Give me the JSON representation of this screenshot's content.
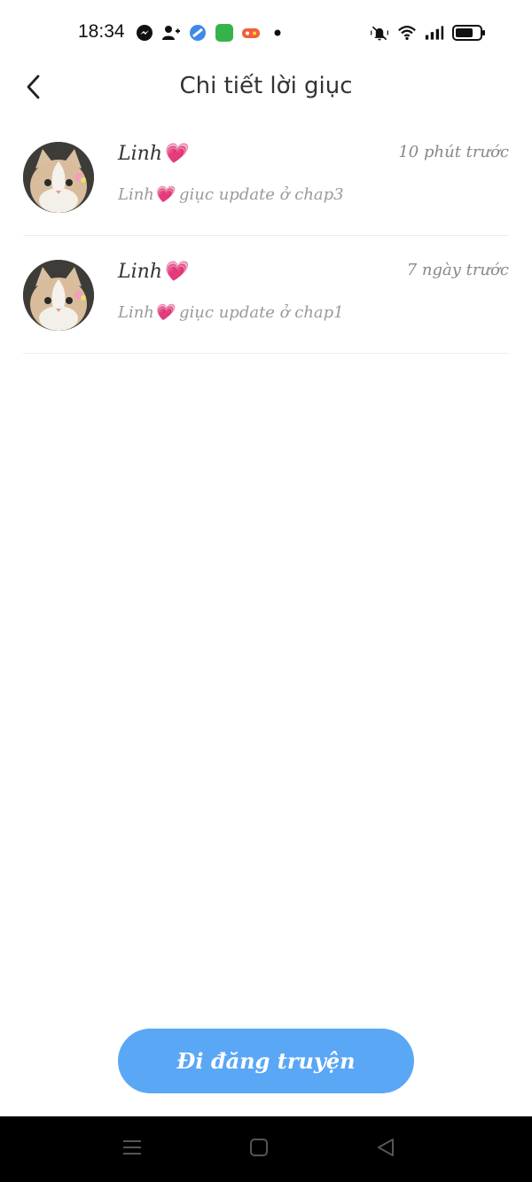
{
  "status_bar": {
    "time": "18:34",
    "left_icons": [
      "messenger-icon",
      "add-contact-icon",
      "blue-app-icon",
      "green-app-icon",
      "game-app-icon",
      "notification-dot-icon"
    ],
    "right_icons": [
      "mute-icon",
      "wifi-icon",
      "signal-icon",
      "battery-icon"
    ]
  },
  "header": {
    "back_icon": "chevron-left-icon",
    "title": "Chi tiết lời giục"
  },
  "items": [
    {
      "name": "Linh💗",
      "time": "10 phút trước",
      "message": "Linh💗 giục update ở chap3",
      "avatar": "cat-avatar"
    },
    {
      "name": "Linh💗",
      "time": "7 ngày trước",
      "message": "Linh💗 giục update ở chap1",
      "avatar": "cat-avatar"
    }
  ],
  "cta": {
    "label": "Đi đăng truyện"
  },
  "nav_bar": {
    "icons": [
      "menu-icon",
      "home-icon",
      "back-triangle-icon"
    ]
  },
  "colors": {
    "accent": "#5aa7f6",
    "nav_background": "#000000",
    "divider": "#ececec"
  }
}
